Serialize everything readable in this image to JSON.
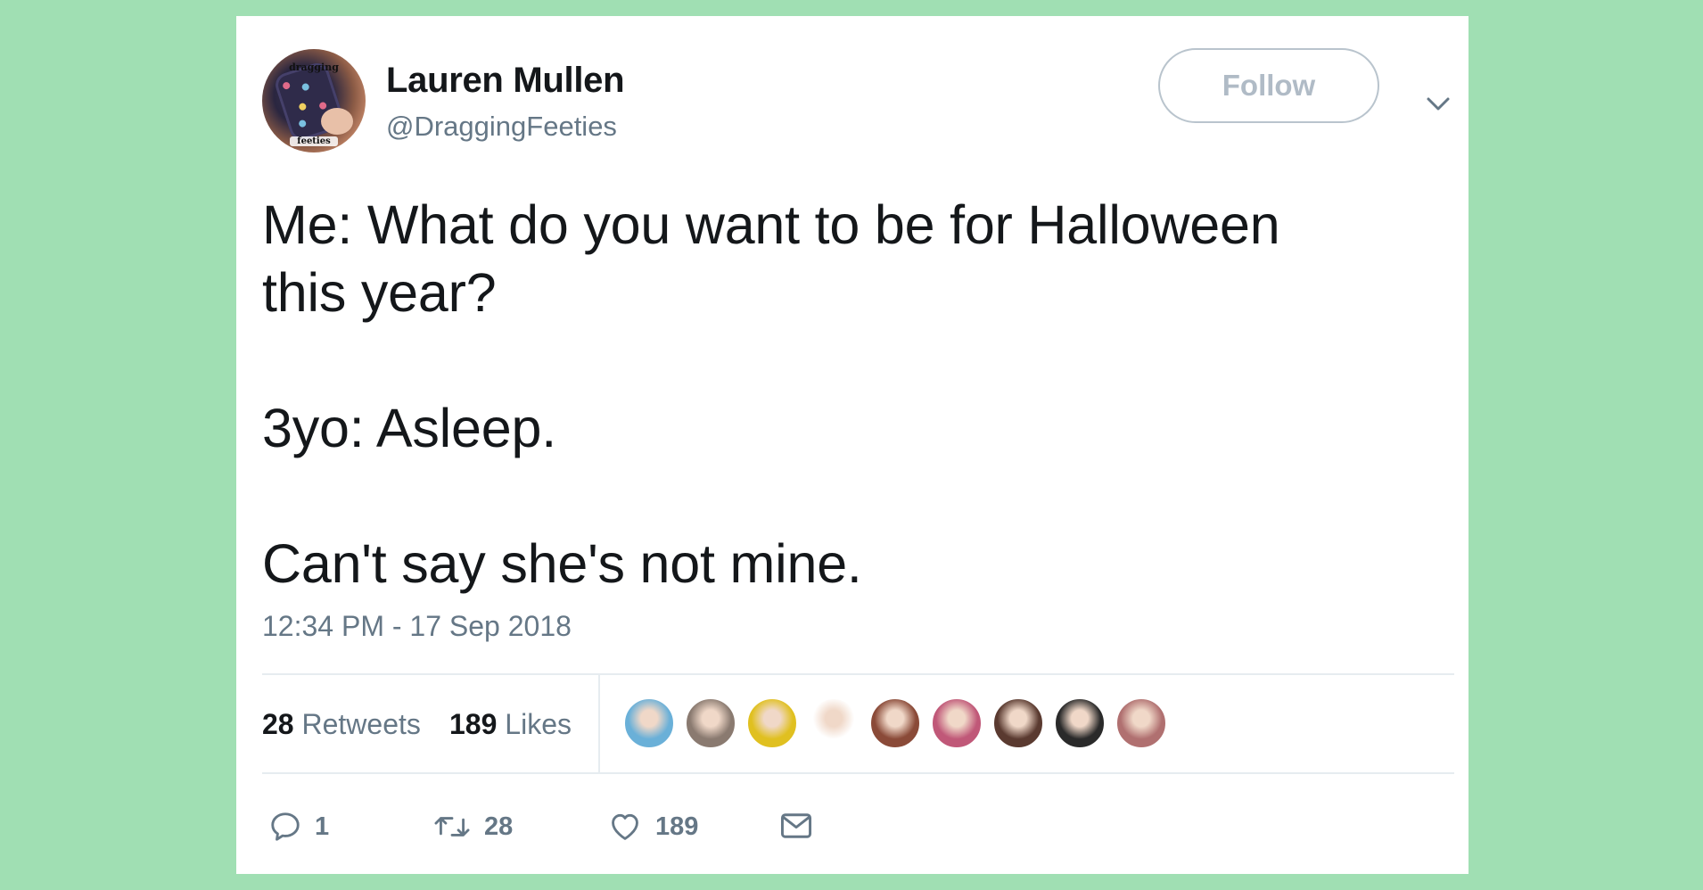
{
  "user": {
    "display_name": "Lauren Mullen",
    "handle": "@DraggingFeeties",
    "avatar_text_top": "dragging",
    "avatar_text_bottom": "feeties"
  },
  "follow_label": "Follow",
  "tweet": {
    "text": "Me: What do you want to be for Halloween\nthis year?\n\n3yo: Asleep.\n\nCan't say she's not mine.",
    "timestamp": "12:34 PM - 17 Sep 2018"
  },
  "stats": {
    "retweets_count": "28",
    "retweets_label": "Retweets",
    "likes_count": "189",
    "likes_label": "Likes"
  },
  "likers": [
    {
      "name": "liker-avatar-1",
      "color": "#6ab0d8"
    },
    {
      "name": "liker-avatar-2",
      "color": "#8a7a70"
    },
    {
      "name": "liker-avatar-3",
      "color": "#e0c020"
    },
    {
      "name": "liker-avatar-4",
      "color": "#ffffff"
    },
    {
      "name": "liker-avatar-5",
      "color": "#8a4a38"
    },
    {
      "name": "liker-avatar-6",
      "color": "#c05878"
    },
    {
      "name": "liker-avatar-7",
      "color": "#5a3a30"
    },
    {
      "name": "liker-avatar-8",
      "color": "#2a2a2a"
    },
    {
      "name": "liker-avatar-9",
      "color": "#b07070"
    }
  ],
  "actions": {
    "reply_count": "1",
    "retweet_count": "28",
    "like_count": "189"
  },
  "colors": {
    "background": "#a0dfb3",
    "text_primary": "#14171a",
    "text_secondary": "#657786",
    "divider": "#e6ecf0"
  }
}
